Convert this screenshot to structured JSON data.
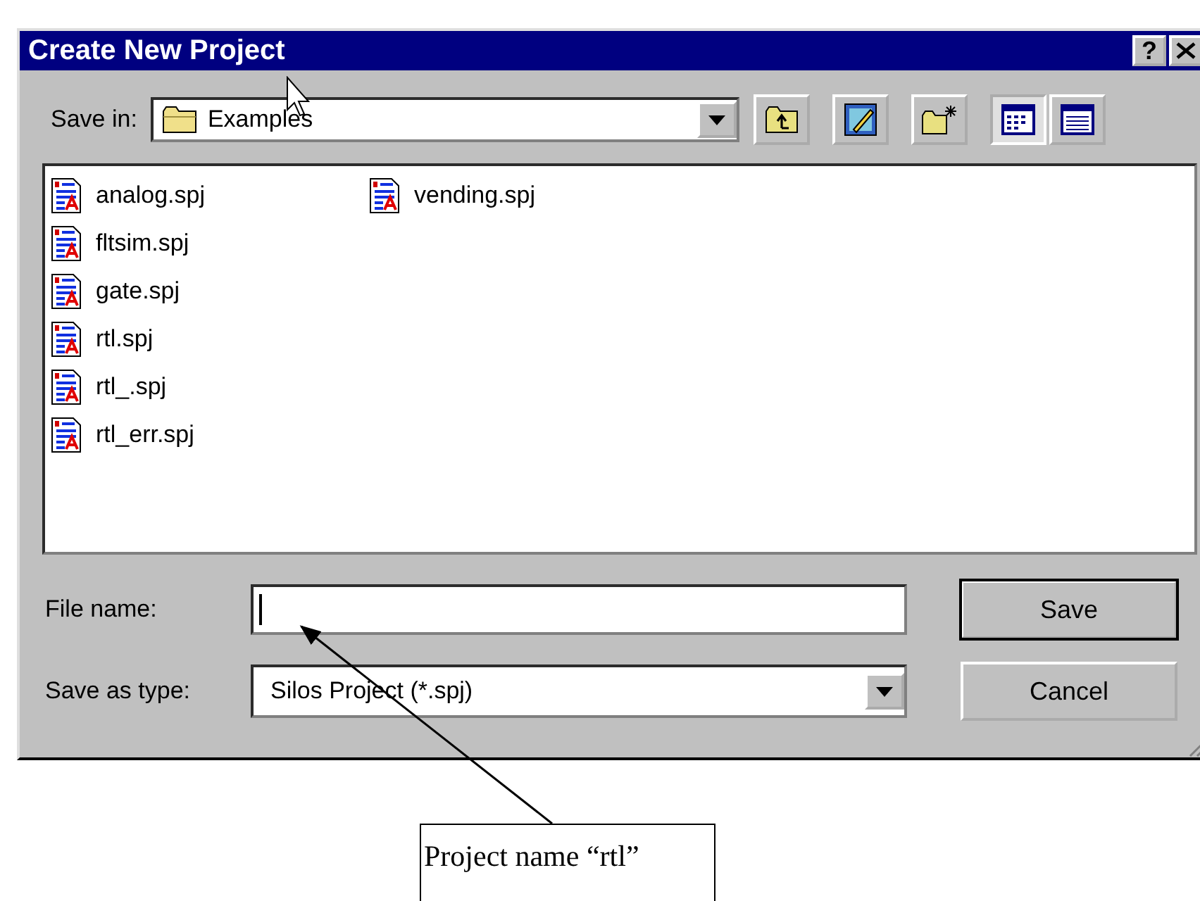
{
  "window": {
    "title": "Create New Project",
    "help_button": "?"
  },
  "save_in": {
    "label": "Save in:",
    "value": "Examples"
  },
  "toolbar": [
    {
      "kind": "up-folder",
      "selected": false
    },
    {
      "kind": "desktop",
      "selected": false
    },
    {
      "kind": "new-folder",
      "selected": false
    },
    {
      "kind": "list-view",
      "selected": true
    },
    {
      "kind": "details-view",
      "selected": false
    }
  ],
  "files": [
    "analog.spj",
    "fltsim.spj",
    "gate.spj",
    "rtl.spj",
    "rtl_.spj",
    "rtl_err.spj",
    "vending.spj"
  ],
  "file_name": {
    "label": "File name:",
    "focused": true
  },
  "save_as_type": {
    "label": "Save as type:",
    "value": "Silos Project (*.spj)"
  },
  "buttons": [
    {
      "label": "Save",
      "default": true
    },
    {
      "label": "Cancel",
      "default": false
    }
  ],
  "callout": {
    "text": "Project name “rtl”"
  }
}
